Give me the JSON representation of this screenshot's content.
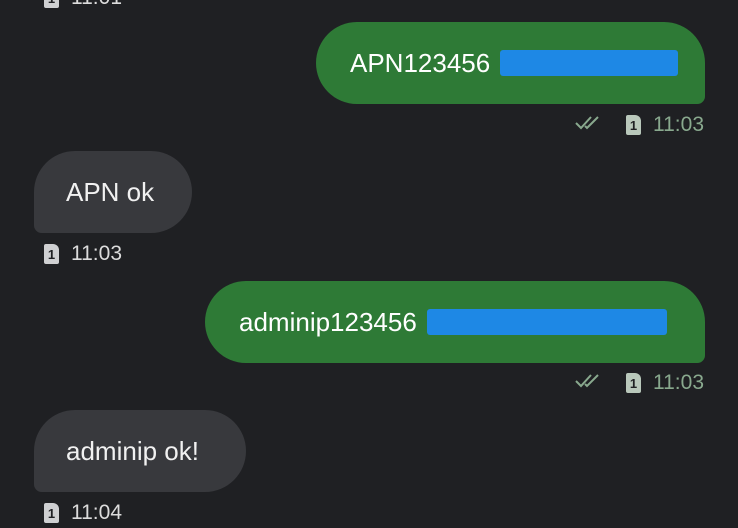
{
  "messages": [
    {
      "direction": "outgoing",
      "text": "APN123456",
      "time": "11:03",
      "sim": "1"
    },
    {
      "direction": "incoming",
      "text": "APN ok",
      "time": "11:03",
      "sim": "1"
    },
    {
      "direction": "outgoing",
      "text": "adminip123456",
      "time": "11:03",
      "sim": "1"
    },
    {
      "direction": "incoming",
      "text": "adminip ok!",
      "time": "11:04",
      "sim": "1"
    }
  ],
  "colors": {
    "background": "#1f2023",
    "outgoing_bubble": "#2e7a36",
    "incoming_bubble": "#38393d",
    "redaction": "#1e88e5"
  }
}
